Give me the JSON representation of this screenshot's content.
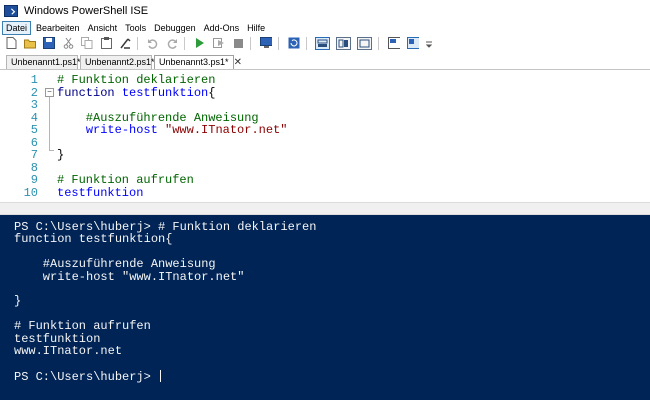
{
  "window": {
    "title": "Windows PowerShell ISE"
  },
  "menu": {
    "items": [
      "Datei",
      "Bearbeiten",
      "Ansicht",
      "Tools",
      "Debuggen",
      "Add-Ons",
      "Hilfe"
    ],
    "active": "Datei"
  },
  "toolbar": {
    "icons": [
      "new-file-icon",
      "open-folder-icon",
      "save-icon",
      "cut-icon",
      "copy-icon",
      "paste-icon",
      "clear-icon",
      "undo-icon",
      "redo-icon",
      "run-icon",
      "run-selection-icon",
      "stop-icon",
      "remote-powershell-icon",
      "refresh-icon",
      "layout-script-top-icon",
      "layout-script-right-icon",
      "layout-script-max-icon",
      "show-script-pane-icon",
      "show-commands-icon",
      "toolbar-overflow-icon"
    ]
  },
  "tabs": [
    {
      "label": "Unbenannt1.ps1*",
      "active": false
    },
    {
      "label": "Unbenannt2.ps1*",
      "active": false
    },
    {
      "label": "Unbenannt3.ps1*",
      "active": true,
      "close": "✕"
    }
  ],
  "editor": {
    "lines": [
      {
        "n": "1",
        "tokens": [
          {
            "t": "# Funktion deklarieren",
            "c": "comment",
            "indent": ""
          }
        ]
      },
      {
        "n": "2",
        "fold": "−",
        "tokens": [
          {
            "t": "function",
            "c": "kw"
          },
          {
            "t": " ",
            "c": "plain"
          },
          {
            "t": "testfunktion",
            "c": "fn"
          },
          {
            "t": "{",
            "c": "plain"
          }
        ]
      },
      {
        "n": "3",
        "tokens": []
      },
      {
        "n": "4",
        "tokens": [
          {
            "t": "    #Auszuführende Anweisung",
            "c": "comment"
          }
        ]
      },
      {
        "n": "5",
        "tokens": [
          {
            "t": "    ",
            "c": "plain"
          },
          {
            "t": "write-host",
            "c": "cmd"
          },
          {
            "t": " ",
            "c": "plain"
          },
          {
            "t": "\"www.ITnator.net\"",
            "c": "str"
          }
        ]
      },
      {
        "n": "6",
        "tokens": []
      },
      {
        "n": "7",
        "tokens": [
          {
            "t": "}",
            "c": "plain"
          }
        ]
      },
      {
        "n": "8",
        "tokens": []
      },
      {
        "n": "9",
        "tokens": [
          {
            "t": "# Funktion aufrufen",
            "c": "comment"
          }
        ]
      },
      {
        "n": "10",
        "tokens": [
          {
            "t": "testfunktion",
            "c": "cmd"
          }
        ]
      }
    ]
  },
  "console": {
    "lines": [
      "PS C:\\Users\\huberj> # Funktion deklarieren",
      "function testfunktion{",
      "",
      "    #Auszuführende Anweisung",
      "    write-host \"www.ITnator.net\"",
      "",
      "}",
      "",
      "# Funktion aufrufen",
      "testfunktion",
      "www.ITnator.net",
      "",
      "PS C:\\Users\\huberj> "
    ]
  },
  "colors": {
    "console_bg": "#012456",
    "console_fg": "#f5f5f5",
    "line_number": "#2b91af",
    "comment": "#006400",
    "keyword": "#00008b",
    "command": "#0000ff",
    "string": "#8b0000"
  }
}
